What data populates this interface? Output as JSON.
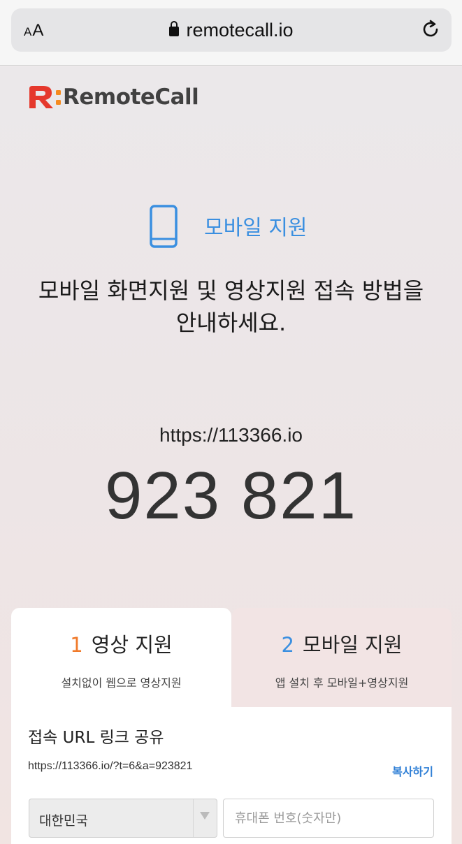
{
  "browser": {
    "aa_label_small": "A",
    "aa_label_large": "A",
    "url": "remotecall.io"
  },
  "logo": {
    "text": "RemoteCall",
    "colors": {
      "r_mark": "#e5382c",
      "dots": "#f58a1f",
      "text": "#414141"
    }
  },
  "hero": {
    "mode_title": "모바일 지원",
    "description_line1": "모바일 화면지원 및 영상지원 접속 방법을",
    "description_line2": "안내하세요.",
    "site_url": "https://113366.io",
    "code": "923 821"
  },
  "tabs": [
    {
      "number": "1",
      "title": "영상 지원",
      "subtitle": "설치없이 웹으로 영상지원"
    },
    {
      "number": "2",
      "title": "모바일 지원",
      "subtitle": "앱 설치 후 모바일+영상지원"
    }
  ],
  "share": {
    "title": "접속 URL 링크 공유",
    "link": "https://113366.io/?t=6&a=923821",
    "copy_label": "복사하기",
    "country": "대한민국",
    "phone_placeholder": "휴대폰 번호(숫자만)"
  },
  "colors": {
    "accent_blue": "#3a8fe0",
    "accent_orange": "#f07a2a"
  }
}
